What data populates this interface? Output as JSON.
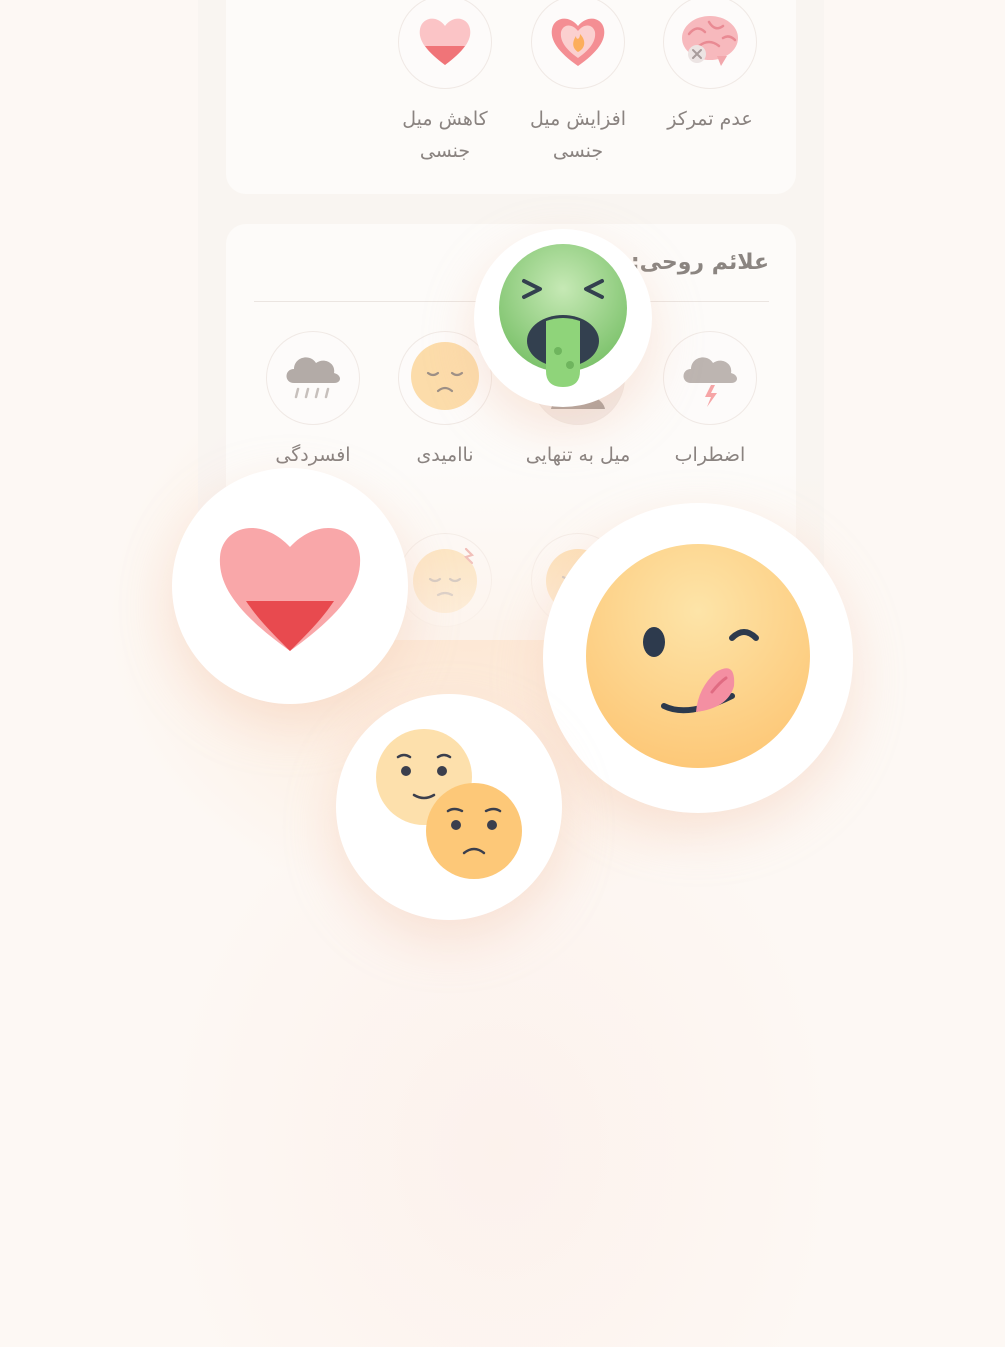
{
  "top_symptoms": [
    {
      "label": "عدم تمرکز",
      "icon": "brain-icon"
    },
    {
      "label": "افزایش میل جنسی",
      "icon": "heart-fire-icon"
    },
    {
      "label": "کاهش میل جنسی",
      "icon": "heart-low-icon"
    }
  ],
  "mental_section": {
    "title": "علائم روحی:",
    "items": [
      {
        "label": "اضطراب",
        "icon": "storm-cloud-icon"
      },
      {
        "label": "میل به تنهایی",
        "icon": "alone-icon"
      },
      {
        "label": "ناامیدی",
        "icon": "sad-face-icon"
      },
      {
        "label": "افسردگی",
        "icon": "rain-cloud-icon"
      }
    ],
    "partial_row_icons": [
      "annoyed-face-icon",
      "tired-face-icon"
    ]
  },
  "floating_icons": [
    "nausea-face-icon",
    "heart-low-icon",
    "craving-face-icon",
    "worried-faces-icon"
  ],
  "colors": {
    "background": "#fdf8f4",
    "card": "#fdfbf9",
    "label_text": "#8a8380",
    "emoji_yellow": "#fdc878",
    "heart_pink": "#f9a7a9",
    "heart_red": "#e84a4f",
    "nausea_green": "#8ccf80"
  }
}
